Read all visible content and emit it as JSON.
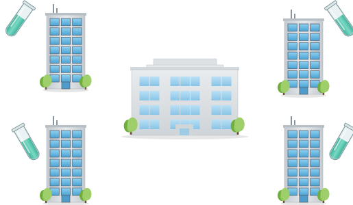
{
  "scene": {
    "background_color": "#ffffff",
    "colors": {
      "facade": "#d9dde1",
      "facade_shade": "#b9c0c6",
      "window": "#6fb9e0",
      "window_frame": "#5a6570",
      "tree_light": "#9fcf6a",
      "tree_dark": "#6fae3c",
      "trunk": "#6b4a2b",
      "tube_liquid": "#58c7b0",
      "tube_glass": "#eaf2f3",
      "tube_outline": "#7f9aa0",
      "ground_shadow": "#e6e6e6"
    },
    "tall_buildings": [
      {
        "name": "tall-building-top-left",
        "floors": 7,
        "columns": 3
      },
      {
        "name": "tall-building-top-right",
        "floors": 7,
        "columns": 3
      },
      {
        "name": "tall-building-bottom-left",
        "floors": 7,
        "columns": 3
      },
      {
        "name": "tall-building-bottom-right",
        "floors": 7,
        "columns": 3
      }
    ],
    "main_building": {
      "name": "central-office-building",
      "floors": 4,
      "window_groups": 3
    },
    "test_tubes": [
      {
        "name": "test-tube-top-left",
        "liquid": "teal"
      },
      {
        "name": "test-tube-top-right",
        "liquid": "teal"
      },
      {
        "name": "test-tube-bottom-left",
        "liquid": "teal"
      },
      {
        "name": "test-tube-bottom-right",
        "liquid": "teal"
      }
    ]
  }
}
